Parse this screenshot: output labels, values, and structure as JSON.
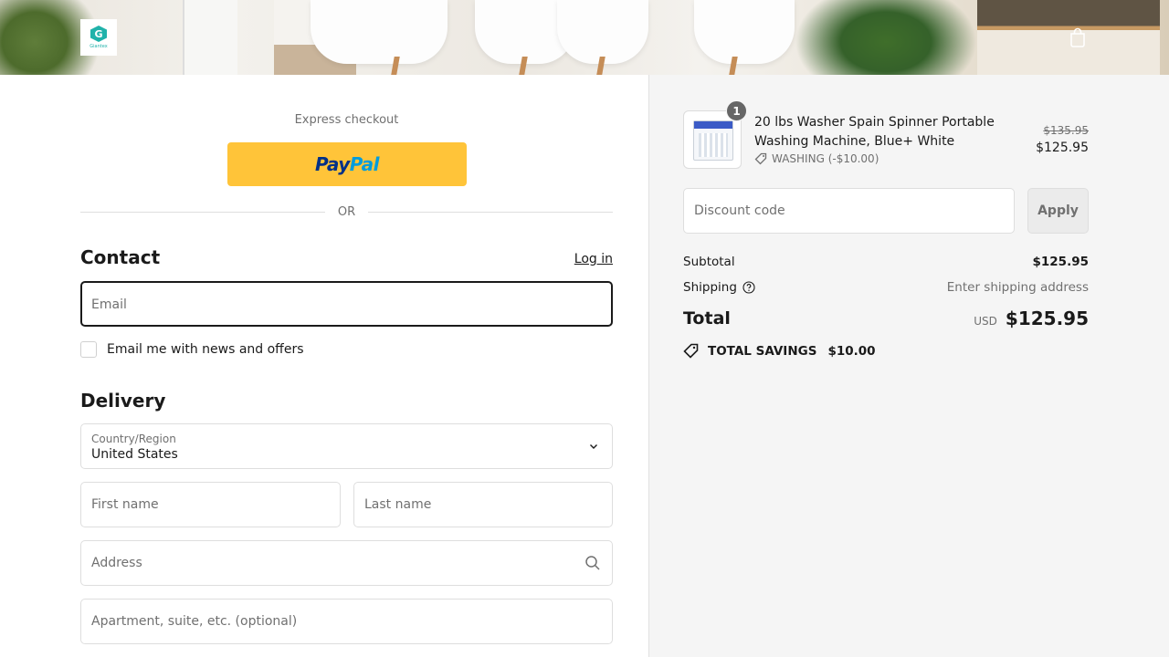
{
  "header": {
    "logo_text": "Giantex",
    "logo_letter": "G",
    "cart_icon": "shopping-bag-icon"
  },
  "express": {
    "label": "Express checkout",
    "paypal_pay": "Pay",
    "paypal_pal": "Pal",
    "or_text": "OR"
  },
  "contact": {
    "title": "Contact",
    "login_label": "Log in",
    "email_placeholder": "Email",
    "newsletter_label": "Email me with news and offers"
  },
  "delivery": {
    "title": "Delivery",
    "country_label": "Country/Region",
    "country_value": "United States",
    "first_name_placeholder": "First name",
    "last_name_placeholder": "Last name",
    "address_placeholder": "Address",
    "apartment_placeholder": "Apartment, suite, etc. (optional)"
  },
  "order": {
    "product": {
      "quantity": "1",
      "name": "20 lbs Washer Spain Spinner Portable Washing Machine, Blue+ White",
      "discount_label": "WASHING (-$10.00)",
      "price_original": "$135.95",
      "price_final": "$125.95"
    },
    "discount_placeholder": "Discount code",
    "apply_label": "Apply",
    "subtotal_label": "Subtotal",
    "subtotal_value": "$125.95",
    "shipping_label": "Shipping",
    "shipping_value": "Enter shipping address",
    "total_label": "Total",
    "currency": "USD",
    "total_value": "$125.95",
    "savings_label": "TOTAL SAVINGS",
    "savings_value": "$10.00"
  },
  "colors": {
    "paypal_yellow": "#ffc439",
    "paypal_navy": "#003087",
    "paypal_blue": "#009cde",
    "summary_bg": "#f5f5f5",
    "brand_teal": "#20b2aa"
  }
}
